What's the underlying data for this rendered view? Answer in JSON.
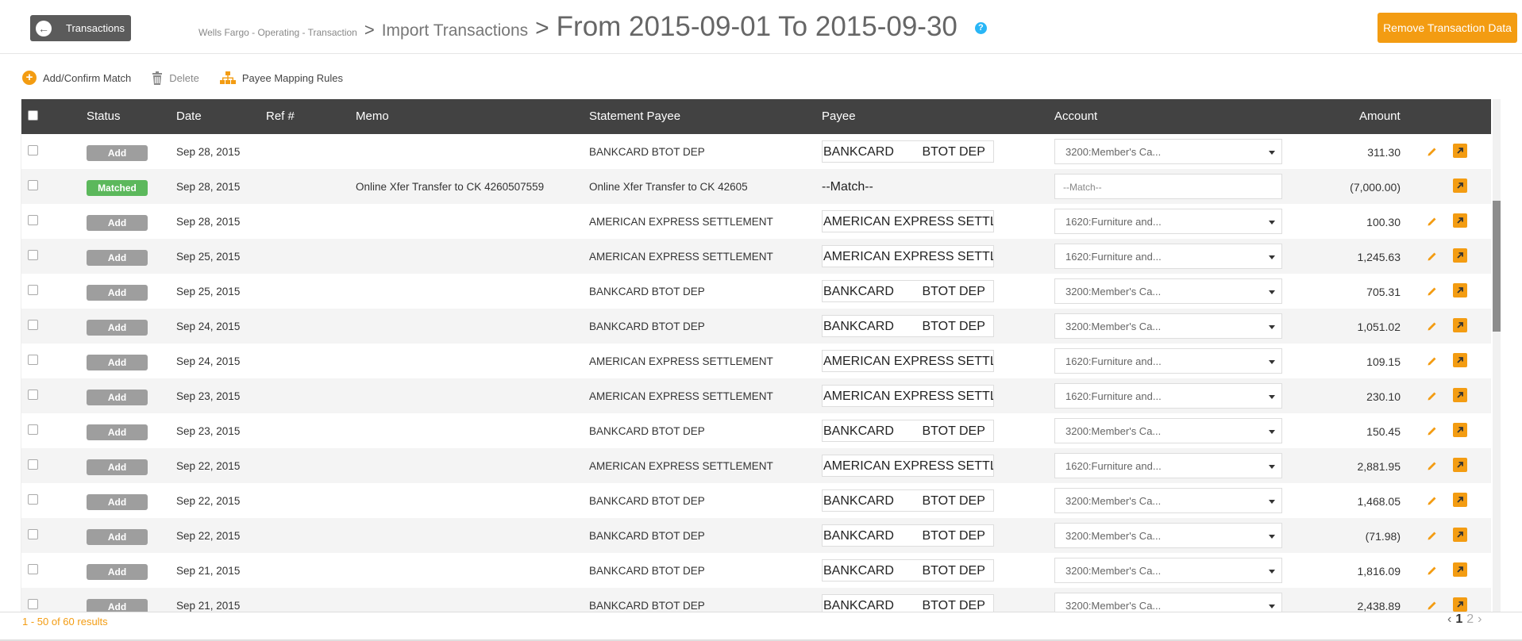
{
  "header": {
    "back_label": "Transactions",
    "breadcrumb_account": "Wells Fargo - Operating - Transaction",
    "breadcrumb_sep1": ">",
    "breadcrumb_page": "Import Transactions",
    "breadcrumb_sep2": ">",
    "breadcrumb_title": "From 2015-09-01 To 2015-09-30",
    "help_glyph": "?",
    "remove_label": "Remove Transaction Data"
  },
  "toolbar": {
    "add_confirm_label": "Add/Confirm Match",
    "delete_label": "Delete",
    "payee_mapping_label": "Payee Mapping Rules"
  },
  "table": {
    "columns": {
      "status": "Status",
      "date": "Date",
      "ref": "Ref #",
      "memo": "Memo",
      "statement_payee": "Statement Payee",
      "payee": "Payee",
      "account": "Account",
      "amount": "Amount"
    },
    "rows": [
      {
        "status": "Add",
        "date": "Sep 28, 2015",
        "ref": "",
        "memo": "",
        "statement_payee": "BANKCARD BTOT DEP",
        "payee": "BANKCARD        BTOT DEP",
        "account": "3200:Member's Ca...",
        "amount": "311.30"
      },
      {
        "status": "Matched",
        "date": "Sep 28, 2015",
        "ref": "",
        "memo": "Online Xfer Transfer to CK 4260507559",
        "statement_payee": "Online Xfer Transfer to CK 42605",
        "payee": "--Match--",
        "account": "--Match--",
        "amount": "(7,000.00)"
      },
      {
        "status": "Add",
        "date": "Sep 28, 2015",
        "ref": "",
        "memo": "",
        "statement_payee": "AMERICAN EXPRESS SETTLEMENT",
        "payee": "AMERICAN EXPRESS SETTLEMENT",
        "account": "1620:Furniture and...",
        "amount": "100.30"
      },
      {
        "status": "Add",
        "date": "Sep 25, 2015",
        "ref": "",
        "memo": "",
        "statement_payee": "AMERICAN EXPRESS SETTLEMENT",
        "payee": "AMERICAN EXPRESS SETTLEMENT",
        "account": "1620:Furniture and...",
        "amount": "1,245.63"
      },
      {
        "status": "Add",
        "date": "Sep 25, 2015",
        "ref": "",
        "memo": "",
        "statement_payee": "BANKCARD BTOT DEP",
        "payee": "BANKCARD        BTOT DEP",
        "account": "3200:Member's Ca...",
        "amount": "705.31"
      },
      {
        "status": "Add",
        "date": "Sep 24, 2015",
        "ref": "",
        "memo": "",
        "statement_payee": "BANKCARD BTOT DEP",
        "payee": "BANKCARD        BTOT DEP",
        "account": "3200:Member's Ca...",
        "amount": "1,051.02"
      },
      {
        "status": "Add",
        "date": "Sep 24, 2015",
        "ref": "",
        "memo": "",
        "statement_payee": "AMERICAN EXPRESS SETTLEMENT",
        "payee": "AMERICAN EXPRESS SETTLEMENT",
        "account": "1620:Furniture and...",
        "amount": "109.15"
      },
      {
        "status": "Add",
        "date": "Sep 23, 2015",
        "ref": "",
        "memo": "",
        "statement_payee": "AMERICAN EXPRESS SETTLEMENT",
        "payee": "AMERICAN EXPRESS SETTLEMENT",
        "account": "1620:Furniture and...",
        "amount": "230.10"
      },
      {
        "status": "Add",
        "date": "Sep 23, 2015",
        "ref": "",
        "memo": "",
        "statement_payee": "BANKCARD BTOT DEP",
        "payee": "BANKCARD        BTOT DEP",
        "account": "3200:Member's Ca...",
        "amount": "150.45"
      },
      {
        "status": "Add",
        "date": "Sep 22, 2015",
        "ref": "",
        "memo": "",
        "statement_payee": "AMERICAN EXPRESS SETTLEMENT",
        "payee": "AMERICAN EXPRESS SETTLEMENT",
        "account": "1620:Furniture and...",
        "amount": "2,881.95"
      },
      {
        "status": "Add",
        "date": "Sep 22, 2015",
        "ref": "",
        "memo": "",
        "statement_payee": "BANKCARD BTOT DEP",
        "payee": "BANKCARD        BTOT DEP",
        "account": "3200:Member's Ca...",
        "amount": "1,468.05"
      },
      {
        "status": "Add",
        "date": "Sep 22, 2015",
        "ref": "",
        "memo": "",
        "statement_payee": "BANKCARD BTOT DEP",
        "payee": "BANKCARD        BTOT DEP",
        "account": "3200:Member's Ca...",
        "amount": "(71.98)"
      },
      {
        "status": "Add",
        "date": "Sep 21, 2015",
        "ref": "",
        "memo": "",
        "statement_payee": "BANKCARD BTOT DEP",
        "payee": "BANKCARD        BTOT DEP",
        "account": "3200:Member's Ca...",
        "amount": "1,816.09"
      },
      {
        "status": "Add",
        "date": "Sep 21, 2015",
        "ref": "",
        "memo": "",
        "statement_payee": "BANKCARD BTOT DEP",
        "payee": "BANKCARD        BTOT DEP",
        "account": "3200:Member's Ca...",
        "amount": "2,438.89"
      }
    ]
  },
  "footer": {
    "results_text": "1 - 50 of 60 results",
    "pager_prev": "‹",
    "pager_current": "1",
    "pager_next_page": "2",
    "pager_next": "›"
  },
  "colors": {
    "accent": "#f39c12",
    "header_bg": "#424242",
    "matched": "#5cb85c",
    "add": "#9e9e9e",
    "help": "#29b6f6"
  }
}
